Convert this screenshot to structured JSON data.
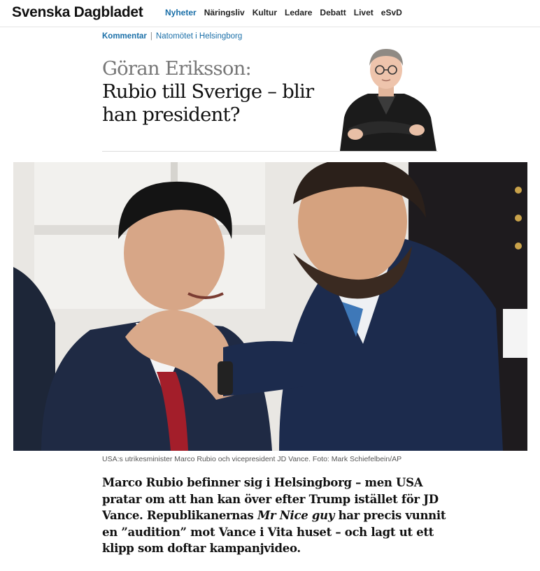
{
  "header": {
    "logo": "Svenska Dagbladet",
    "nav": [
      {
        "label": "Nyheter",
        "active": true
      },
      {
        "label": "Näringsliv"
      },
      {
        "label": "Kultur"
      },
      {
        "label": "Ledare"
      },
      {
        "label": "Debatt"
      },
      {
        "label": "Livet"
      },
      {
        "label": "eSvD"
      }
    ]
  },
  "article": {
    "kicker": {
      "section": "Kommentar",
      "separator": "|",
      "topic": "Natomötet i Helsingborg"
    },
    "author_prefix": "Göran Eriksson:",
    "title": "Rubio till Sverige – blir han president?",
    "caption": "USA:s utrikesminister Marco Rubio och vicepresident JD Vance. Foto: Mark Schiefelbein/AP",
    "lead": {
      "part1": "Marco Rubio befinner sig i Helsingborg – men USA pratar om att han kan över efter Trump istället för JD Vance. Republikanernas ",
      "emphasis": "Mr Nice guy",
      "part2": " har precis vunnit en ”audition” mot Vance i Vita huset – och lagt ut ett klipp som doftar kampanjvideo."
    }
  },
  "colors": {
    "accent": "#1a6fa8",
    "text": "#111111",
    "author": "#777777"
  }
}
